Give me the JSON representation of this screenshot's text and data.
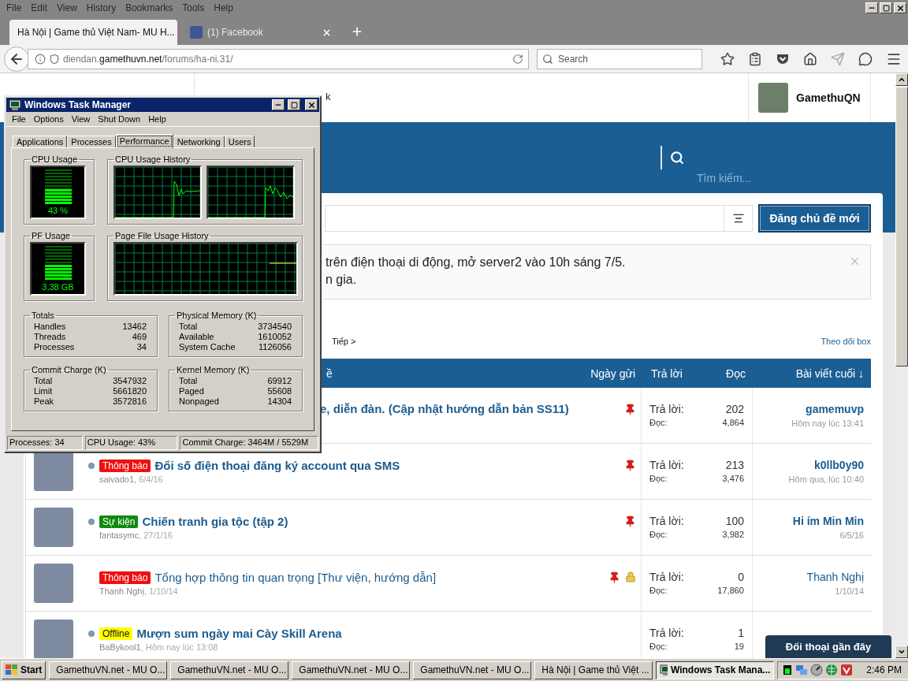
{
  "browser": {
    "menu": [
      "File",
      "Edit",
      "View",
      "History",
      "Bookmarks",
      "Tools",
      "Help"
    ],
    "tabs": [
      {
        "label": "Hà Nội | Game thủ Việt Nam- MU H...",
        "selected": true,
        "kind": "plain"
      },
      {
        "label": "(1) Facebook",
        "selected": false,
        "kind": "favicon"
      }
    ],
    "url": {
      "prefix": "diendan.",
      "domain": "gamethuvn.net",
      "path": "/forums/ha-ni.31/"
    },
    "search": {
      "placeholder": "Search"
    }
  },
  "page": {
    "header_fragment": "k",
    "user": {
      "name": "GamethuQN"
    },
    "search": {
      "placeholder": "Tìm kiếm..."
    },
    "new_thread_button": "Đăng chủ đề mới",
    "notice": {
      "lines": [
        "trên điện thoại di động, mở server2 vào 10h sáng 7/5.",
        "n gia."
      ]
    },
    "pagination": {
      "next": "Tiếp >"
    },
    "watch_link": "Theo dõi box",
    "table": {
      "columns": [
        "ề",
        "Ngày gửi",
        "Trả lời",
        "Đọc",
        "Bài viết cuối ↓"
      ],
      "rows": [
        {
          "kind": "partial",
          "title": "e, diễn đàn. (Cập nhật hướng dẫn bản SS11)",
          "title_bold": true,
          "sticky": true,
          "locked": false,
          "replies_label": "Trả lời:",
          "replies": "202",
          "views_label": "Đọc:",
          "views": "4,864",
          "last_user": "gamemuvp",
          "last_bold": true,
          "last_date": "Hôm nay lúc 13:41"
        },
        {
          "kind": "full",
          "unread": true,
          "tag": {
            "label": "Thông báo",
            "color": "#ee1111"
          },
          "title": "Đổi số điện thoại đăng ký account qua SMS",
          "title_bold": true,
          "author": "saivado1",
          "date": ", 6/4/16",
          "sticky": true,
          "locked": false,
          "replies_label": "Trả lời:",
          "replies": "213",
          "views_label": "Đọc:",
          "views": "3,476",
          "last_user": "k0llb0y90",
          "last_bold": true,
          "last_date": "Hôm qua, lúc 10:40"
        },
        {
          "kind": "full",
          "unread": true,
          "tag": {
            "label": "Sự kiện",
            "color": "#108a10"
          },
          "title": "Chiến tranh gia tộc (tập 2)",
          "title_bold": true,
          "author": "fantasymc",
          "date": ", 27/1/16",
          "sticky": true,
          "locked": false,
          "replies_label": "Trả lời:",
          "replies": "100",
          "views_label": "Đọc:",
          "views": "3,982",
          "last_user": "Hi ím Min Min",
          "last_bold": true,
          "last_date": "6/5/16"
        },
        {
          "kind": "full",
          "unread": false,
          "tag": {
            "label": "Thông báo",
            "color": "#ee1111"
          },
          "title": "Tổng hợp thông tin quan trọng [Thư viện, hướng dẫn]",
          "title_bold": false,
          "author": "Thanh Nghị",
          "date": ", 1/10/14",
          "sticky": true,
          "locked": true,
          "replies_label": "Trả lời:",
          "replies": "0",
          "views_label": "Đọc:",
          "views": "17,860",
          "last_user": "Thanh Nghị",
          "last_bold": false,
          "last_date": "1/10/14"
        },
        {
          "kind": "full",
          "unread": true,
          "tag": {
            "label": "Offline",
            "color": "#ffff00"
          },
          "title": "Mượn sum ngày mai Cày Skill Arena",
          "title_bold": true,
          "author": "BaBykool1",
          "date": ", Hôm nay lúc 13:08",
          "sticky": false,
          "locked": false,
          "replies_label": "Trả lời:",
          "replies": "1",
          "views_label": "Đọc:",
          "views": "19"
        }
      ]
    },
    "chat_bar": "Đối thoại gần đây"
  },
  "task_manager": {
    "title": "Windows Task Manager",
    "menu": [
      "File",
      "Options",
      "View",
      "Shut Down",
      "Help"
    ],
    "tabs": [
      {
        "label": "Applications",
        "selected": false
      },
      {
        "label": "Processes",
        "selected": false
      },
      {
        "label": "Performance",
        "selected": true
      },
      {
        "label": "Networking",
        "selected": false
      },
      {
        "label": "Users",
        "selected": false
      }
    ],
    "cpu_usage": {
      "title": "CPU Usage",
      "reading": "43 %",
      "level": 0.43
    },
    "cpu_history": {
      "title": "CPU Usage History"
    },
    "pf_usage": {
      "title": "PF Usage",
      "reading": "3,38 GB",
      "level": 0.45
    },
    "pf_history": {
      "title": "Page File Usage History"
    },
    "tables": [
      {
        "title": "Totals",
        "rows": [
          {
            "label": "Handles",
            "value": "13462"
          },
          {
            "label": "Threads",
            "value": "469"
          },
          {
            "label": "Processes",
            "value": "34"
          }
        ]
      },
      {
        "title": "Physical Memory (K)",
        "rows": [
          {
            "label": "Total",
            "value": "3734540"
          },
          {
            "label": "Available",
            "value": "1610052"
          },
          {
            "label": "System Cache",
            "value": "1126056"
          }
        ]
      },
      {
        "title": "Commit Charge (K)",
        "rows": [
          {
            "label": "Total",
            "value": "3547932"
          },
          {
            "label": "Limit",
            "value": "5661820"
          },
          {
            "label": "Peak",
            "value": "3572816"
          }
        ]
      },
      {
        "title": "Kernel Memory (K)",
        "rows": [
          {
            "label": "Total",
            "value": "69912"
          },
          {
            "label": "Paged",
            "value": "55608"
          },
          {
            "label": "Nonpaged",
            "value": "14304"
          }
        ]
      }
    ],
    "status": [
      "Processes: 34",
      "CPU Usage: 43%",
      "Commit Charge: 3464M / 5529M"
    ]
  },
  "taskbar": {
    "start": "Start",
    "tasks": [
      {
        "label": "GamethuVN.net - MU O...",
        "kind": "game",
        "selected": false
      },
      {
        "label": "GamethuVN.net - MU O...",
        "kind": "game",
        "selected": false
      },
      {
        "label": "GamethuVN.net - MU O...",
        "kind": "game",
        "selected": false
      },
      {
        "label": "GamethuVN.net - MU O...",
        "kind": "game",
        "selected": false
      },
      {
        "label": "Hà Nội | Game thủ Việt ...",
        "kind": "browser",
        "selected": false
      },
      {
        "label": "Windows Task Mana...",
        "kind": "taskmgr",
        "selected": true
      }
    ],
    "clock": "2:46 PM"
  }
}
